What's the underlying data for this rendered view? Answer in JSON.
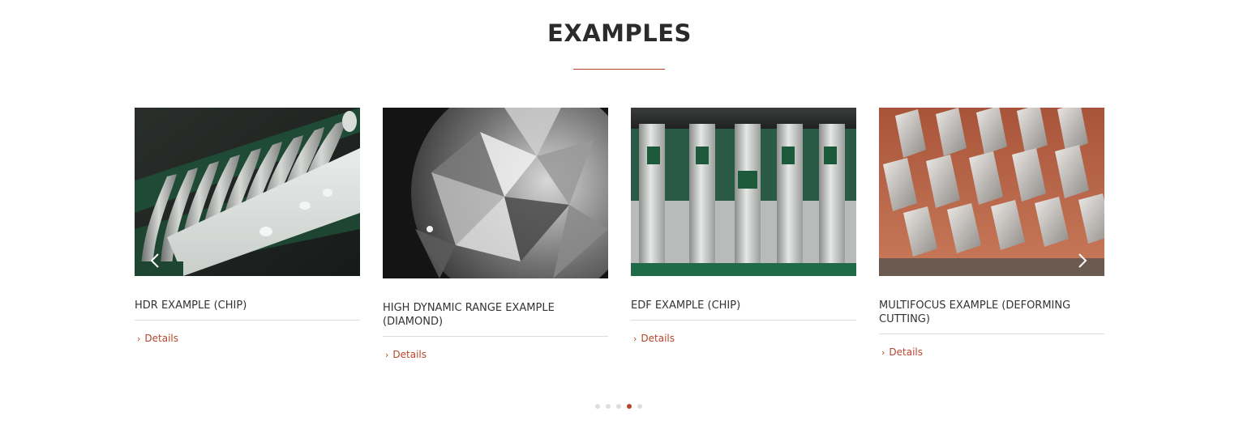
{
  "section": {
    "heading": "EXAMPLES"
  },
  "cards": [
    {
      "title": "HDR EXAMPLE (CHIP)",
      "link": "Details",
      "image": "chip-hdr-photo"
    },
    {
      "title": "HIGH DYNAMIC RANGE EXAMPLE (DIAMOND)",
      "link": "Details",
      "image": "diamond-photo"
    },
    {
      "title": "EDF EXAMPLE (CHIP)",
      "link": "Details",
      "image": "chip-edf-photo"
    },
    {
      "title": "MULTIFOCUS EXAMPLE (DEFORMING CUTTING)",
      "link": "Details",
      "image": "deforming-cutting-photo"
    }
  ],
  "carousel": {
    "prev_icon": "chevron-left-icon",
    "next_icon": "chevron-right-icon",
    "dot_count": 5,
    "active_dot": 4
  },
  "colors": {
    "accent": "#b5452a",
    "heading": "#2b2b2b",
    "divider": "#dcdcdc"
  }
}
